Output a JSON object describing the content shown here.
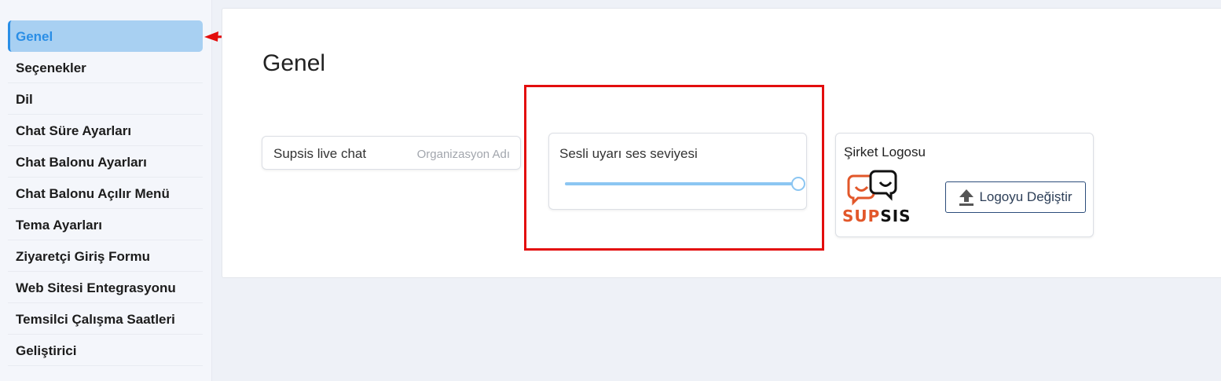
{
  "sidebar": {
    "items": [
      {
        "label": "Genel",
        "active": true
      },
      {
        "label": "Seçenekler"
      },
      {
        "label": "Dil"
      },
      {
        "label": "Chat Süre Ayarları"
      },
      {
        "label": "Chat Balonu Ayarları"
      },
      {
        "label": "Chat Balonu Açılır Menü"
      },
      {
        "label": "Tema Ayarları"
      },
      {
        "label": "Ziyaretçi Giriş Formu"
      },
      {
        "label": "Web Sitesi Entegrasyonu"
      },
      {
        "label": "Temsilci Çalışma Saatleri"
      },
      {
        "label": "Geliştirici"
      }
    ]
  },
  "main": {
    "title": "Genel",
    "org_field": {
      "value": "Supsis live chat",
      "placeholder": "Organizasyon Adı"
    },
    "volume": {
      "label": "Sesli uyarı ses seviyesi",
      "value_percent": 100
    },
    "logo": {
      "label": "Şirket Logosu",
      "brand_sup": "SUP",
      "brand_sis": "SIS",
      "change_button": "Logoyu Değiştir"
    }
  },
  "colors": {
    "accent": "#2a8ee6",
    "active_bg": "#a8d0f2",
    "annotation_red": "#e30d0d",
    "brand_orange": "#e2572a"
  },
  "icons": [
    "upload-icon",
    "supsis-logo-icon"
  ]
}
